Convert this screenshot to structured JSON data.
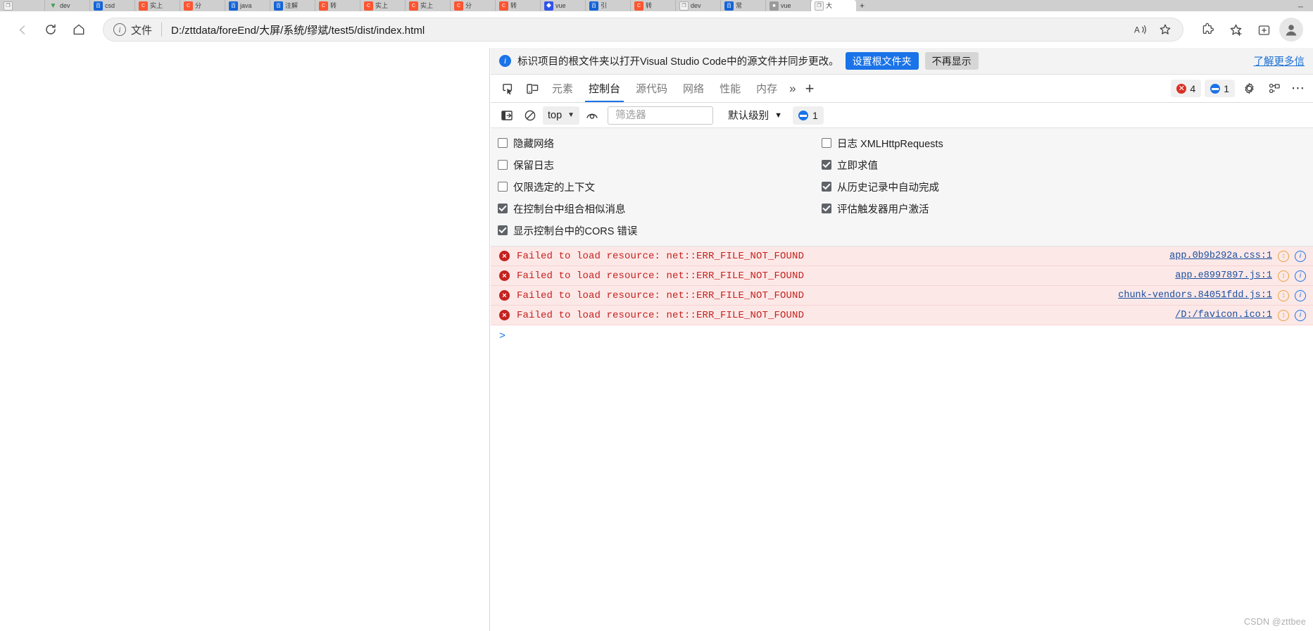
{
  "browser": {
    "tabs": [
      {
        "favicon": "doc-icon",
        "fav_class": "fav-white",
        "fav_glyph": "❐",
        "title": ""
      },
      {
        "favicon": "download-icon",
        "fav_class": "fav-green",
        "fav_glyph": "▼",
        "title": "dev"
      },
      {
        "favicon": "baidu-icon",
        "fav_class": "fav-dblue",
        "fav_glyph": "百",
        "title": "csd"
      },
      {
        "favicon": "csdn-icon",
        "fav_class": "fav-csdn",
        "fav_glyph": "C",
        "title": "实上"
      },
      {
        "favicon": "csdn-icon",
        "fav_class": "fav-csdn",
        "fav_glyph": "C",
        "title": "分"
      },
      {
        "favicon": "baidu-icon",
        "fav_class": "fav-dblue",
        "fav_glyph": "百",
        "title": "java"
      },
      {
        "favicon": "baidu-icon",
        "fav_class": "fav-dblue",
        "fav_glyph": "百",
        "title": "注解"
      },
      {
        "favicon": "csdn-icon",
        "fav_class": "fav-csdn",
        "fav_glyph": "C",
        "title": "转"
      },
      {
        "favicon": "csdn-icon",
        "fav_class": "fav-csdn",
        "fav_glyph": "C",
        "title": "实上"
      },
      {
        "favicon": "csdn-icon",
        "fav_class": "fav-csdn",
        "fav_glyph": "C",
        "title": "实上"
      },
      {
        "favicon": "csdn-icon",
        "fav_class": "fav-csdn",
        "fav_glyph": "C",
        "title": "分"
      },
      {
        "favicon": "csdn-icon",
        "fav_class": "fav-csdn",
        "fav_glyph": "C",
        "title": "转"
      },
      {
        "favicon": "blue-icon",
        "fav_class": "fav-blue",
        "fav_glyph": "◆",
        "title": "vue"
      },
      {
        "favicon": "baidu-icon",
        "fav_class": "fav-dblue",
        "fav_glyph": "百",
        "title": "引"
      },
      {
        "favicon": "csdn-icon",
        "fav_class": "fav-csdn",
        "fav_glyph": "C",
        "title": "转"
      },
      {
        "favicon": "doc-icon",
        "fav_class": "fav-white",
        "fav_glyph": "❐",
        "title": "dev"
      },
      {
        "favicon": "baidu-icon",
        "fav_class": "fav-dblue",
        "fav_glyph": "百",
        "title": "常"
      },
      {
        "favicon": "gray-icon",
        "fav_class": "fav-gray",
        "fav_glyph": "■",
        "title": "vue"
      },
      {
        "favicon": "doc-icon",
        "fav_class": "fav-white",
        "fav_glyph": "❐",
        "title": "大"
      }
    ],
    "new_tab_label": "+",
    "minimize_label": "─",
    "nav": {
      "back": "←",
      "reload": "reload-icon",
      "home": "home-icon"
    },
    "omnibox": {
      "info_glyph": "i",
      "kind_label": "文件",
      "url": "D:/zttdata/foreEnd/大屏/系统/缪斌/test5/dist/index.html",
      "read_aloud_label": "Aᴺ",
      "favorite_label": "☆"
    }
  },
  "devtools": {
    "notification": {
      "text": "标识项目的根文件夹以打开Visual Studio Code中的源文件并同步更改。",
      "primary_button": "设置根文件夹",
      "secondary_button": "不再显示",
      "link": "了解更多信"
    },
    "tabs": [
      {
        "label": "元素",
        "active": false
      },
      {
        "label": "控制台",
        "active": true
      },
      {
        "label": "源代码",
        "active": false
      },
      {
        "label": "网络",
        "active": false
      },
      {
        "label": "性能",
        "active": false
      },
      {
        "label": "内存",
        "active": false
      }
    ],
    "more_tabs_label": "»",
    "add_tab_label": "+",
    "error_count": "4",
    "message_count": "1",
    "error_dot_glyph": "×",
    "message_dot_glyph": "▬",
    "settings_gear": "gear-icon",
    "customize_label": "⋯",
    "console_toolbar": {
      "sidebar_toggle": "sidebar-toggle-icon",
      "clear_console": "clear-console-icon",
      "context_value": "top",
      "context_caret": "▼",
      "eye_icon": "live-expression-icon",
      "filter_placeholder": "筛选器",
      "filter_value": "",
      "levels_label": "默认级别",
      "levels_caret": "▼",
      "msg_badge_count": "1"
    },
    "settings_left": [
      {
        "label": "隐藏网络",
        "checked": false
      },
      {
        "label": "保留日志",
        "checked": false
      },
      {
        "label": "仅限选定的上下文",
        "checked": false
      },
      {
        "label": "在控制台中组合相似消息",
        "checked": true
      },
      {
        "label": "显示控制台中的CORS 错误",
        "checked": true
      }
    ],
    "settings_right": [
      {
        "label": "日志 XMLHttpRequests",
        "checked": false
      },
      {
        "label": "立即求值",
        "checked": true
      },
      {
        "label": "从历史记录中自动完成",
        "checked": true
      },
      {
        "label": "评估触发器用户激活",
        "checked": true
      }
    ],
    "messages": [
      {
        "level": "error",
        "icon_glyph": "×",
        "text": "Failed to load resource: net::ERR_FILE_NOT_FOUND",
        "source": "app.0b9b292a.css:1",
        "issue_glyph": "↕",
        "info_glyph": "i"
      },
      {
        "level": "error",
        "icon_glyph": "×",
        "text": "Failed to load resource: net::ERR_FILE_NOT_FOUND",
        "source": "app.e8997897.js:1",
        "issue_glyph": "↕",
        "info_glyph": "i"
      },
      {
        "level": "error",
        "icon_glyph": "×",
        "text": "Failed to load resource: net::ERR_FILE_NOT_FOUND",
        "source": "chunk-vendors.84051fdd.js:1",
        "issue_glyph": "↕",
        "info_glyph": "i"
      },
      {
        "level": "error",
        "icon_glyph": "×",
        "text": "Failed to load resource: net::ERR_FILE_NOT_FOUND",
        "source": "/D:/favicon.ico:1",
        "issue_glyph": "↕",
        "info_glyph": "i"
      }
    ],
    "prompt_caret": ">"
  },
  "watermark": "CSDN @zttbee",
  "colors": {
    "accent_blue": "#1a73e8",
    "error_red": "#c5221f",
    "error_bg": "#fce8e7",
    "link_blue": "#1a4fa0",
    "panel_bg": "#f6f6f6"
  }
}
